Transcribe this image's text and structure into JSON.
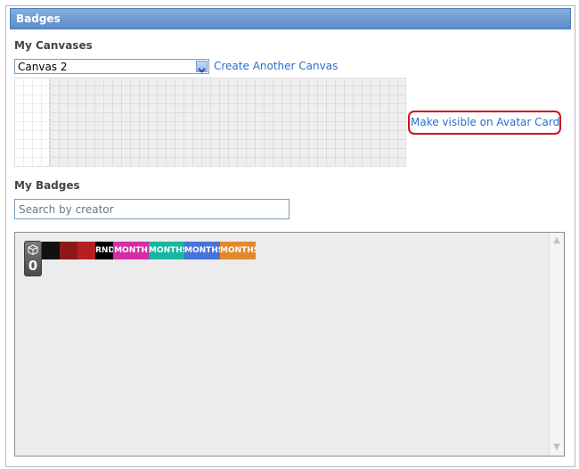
{
  "header": {
    "title": "Badges"
  },
  "canvases": {
    "label": "My Canvases",
    "selected": "Canvas 2",
    "create_link": "Create Another Canvas",
    "visible_link": "Make visible on Avatar Card"
  },
  "badges": {
    "label": "My Badges",
    "search_placeholder": "Search by creator",
    "counter_value": "0",
    "items": [
      {
        "name": "badge-dark-1",
        "text": "",
        "color": "#111111"
      },
      {
        "name": "badge-red-avatar-1",
        "text": "",
        "color": "#8a1a1a"
      },
      {
        "name": "badge-red-avatar-2",
        "text": "",
        "color": "#b52020"
      },
      {
        "name": "badge-rnd",
        "text": "RND",
        "color": "#000000"
      },
      {
        "name": "badge-month",
        "text": "MONTH",
        "color": "#d42da5"
      },
      {
        "name": "badge-months-1",
        "text": "MONTHS",
        "color": "#17b6a0"
      },
      {
        "name": "badge-months-2",
        "text": "MONTHS",
        "color": "#4673d8"
      },
      {
        "name": "badge-months-3",
        "text": "MONTHS",
        "color": "#e08a2c"
      }
    ]
  }
}
